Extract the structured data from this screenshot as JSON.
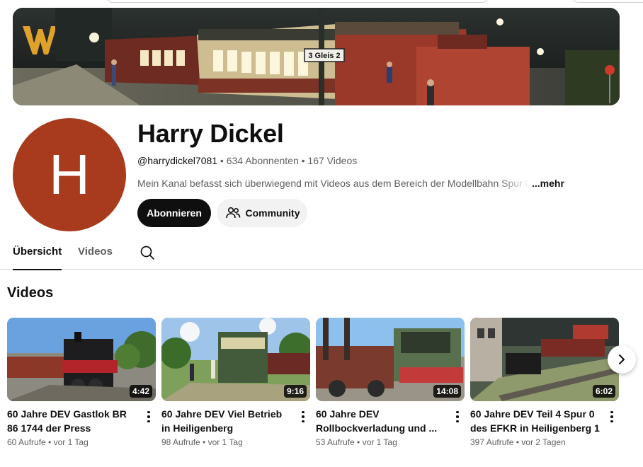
{
  "channel": {
    "name": "Harry Dickel",
    "avatar_letter": "H",
    "avatar_color": "#a83a1d",
    "handle": "@harrydickel7081",
    "subscribers": "634 Abonnenten",
    "video_count": "167 Videos",
    "separator": " • ",
    "description": "Mein Kanal befasst sich überwiegend mit Videos aus dem Bereich der Modellbahn Spur 0",
    "more_label": "...mehr",
    "banner_sign": "3 Gleis 2"
  },
  "actions": {
    "subscribe_label": "Abonnieren",
    "community_label": "Community"
  },
  "tabs": [
    {
      "label": "Übersicht",
      "active": true
    },
    {
      "label": "Videos",
      "active": false
    }
  ],
  "section": {
    "title": "Videos"
  },
  "videos": [
    {
      "title": "60 Jahre DEV Gastlok BR 86 1744 der Press",
      "duration": "4:42",
      "views": "60 Aufrufe",
      "age": "vor 1 Tag"
    },
    {
      "title": "60 Jahre DEV Viel Betrieb in Heiligenberg",
      "duration": "9:16",
      "views": "98 Aufrufe",
      "age": "vor 1 Tag"
    },
    {
      "title": "60 Jahre DEV Rollbockverladung und ...",
      "duration": "14:08",
      "views": "53 Aufrufe",
      "age": "vor 1 Tag"
    },
    {
      "title": "60 Jahre DEV Teil 4 Spur 0 des EFKR in Heiligenberg 1",
      "duration": "6:02",
      "views": "397 Aufrufe",
      "age": "vor 2 Tagen"
    }
  ],
  "colors": {
    "subscribe_bg": "#0f0f0f",
    "chip_bg": "#f2f2f2",
    "text_secondary": "#606060"
  }
}
